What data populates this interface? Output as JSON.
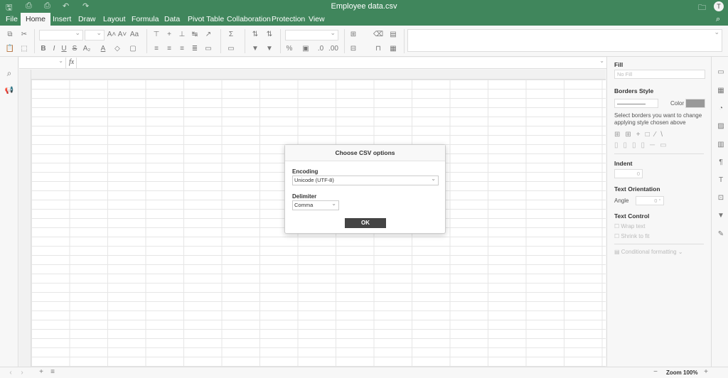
{
  "title": "Employee data.csv",
  "avatar": "T",
  "tabs": [
    "File",
    "Home",
    "Insert",
    "Draw",
    "Layout",
    "Formula",
    "Data",
    "Pivot Table",
    "Collaboration",
    "Protection",
    "View"
  ],
  "formula_bar": {
    "fx": "fx",
    "name_box": "",
    "value": ""
  },
  "right_panel": {
    "fill": "Fill",
    "fill_value": "No Fill",
    "borders_style": "Borders Style",
    "color": "Color",
    "borders_hint": "Select borders you want to change applying style chosen above",
    "indent": "Indent",
    "indent_value": "0",
    "text_orientation": "Text Orientation",
    "angle": "Angle",
    "angle_value": "0 °",
    "text_control": "Text Control",
    "wrap_text": "Wrap text",
    "shrink_to_fit": "Shrink to fit",
    "conditional_formatting": "Conditional formatting"
  },
  "dialog": {
    "title": "Choose CSV options",
    "encoding_label": "Encoding",
    "encoding_value": "Unicode (UTF-8)",
    "delimiter_label": "Delimiter",
    "delimiter_value": "Comma",
    "ok": "OK"
  },
  "status": {
    "zoom": "Zoom 100%"
  }
}
